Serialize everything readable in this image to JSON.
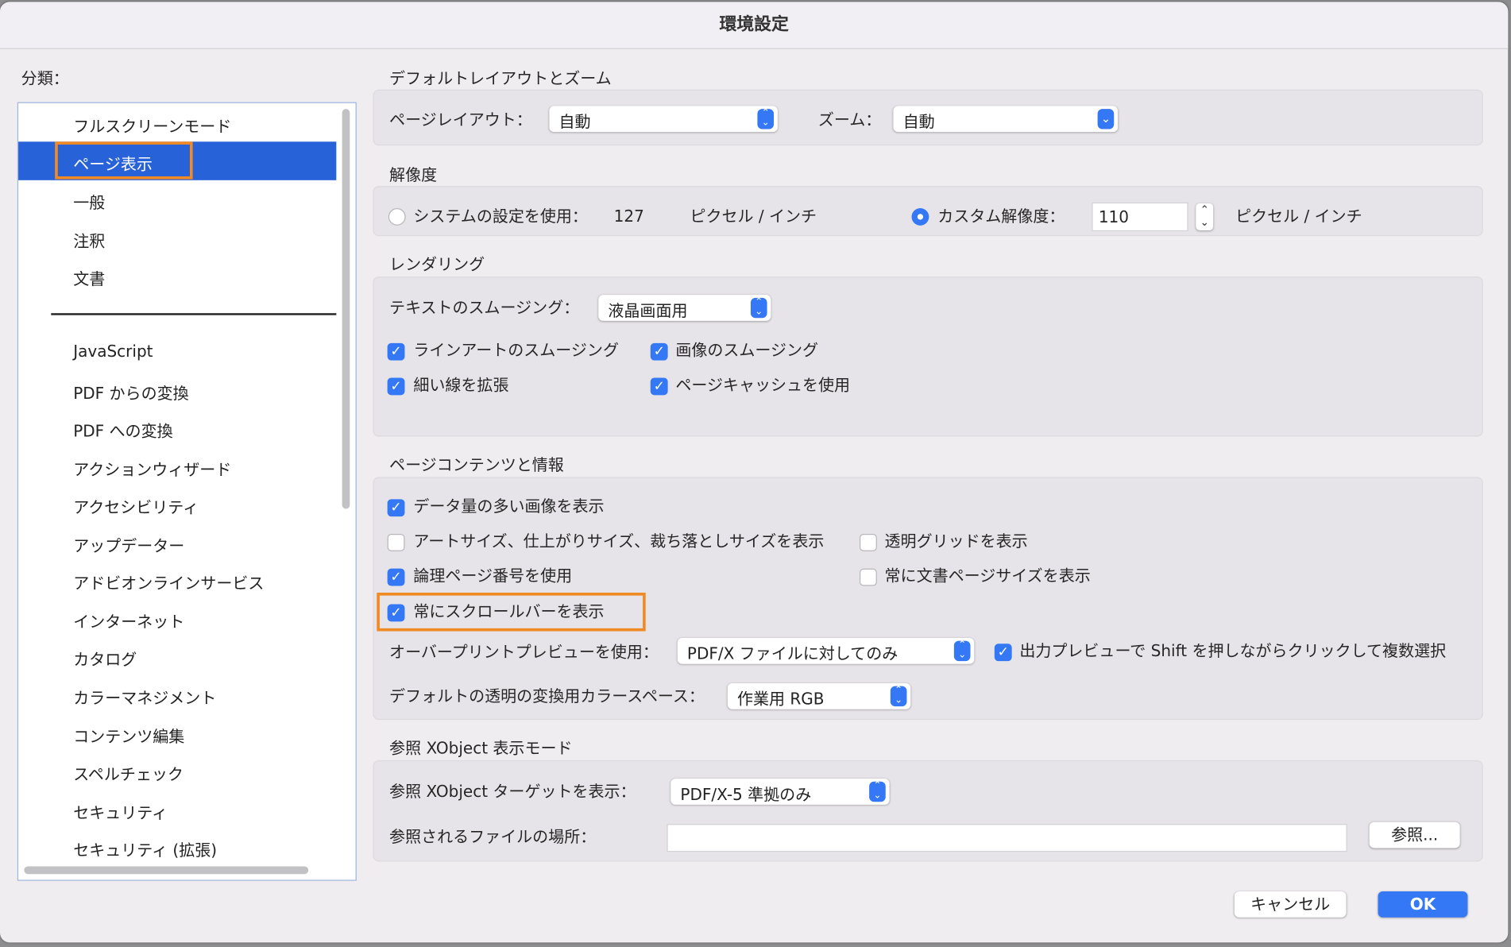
{
  "window": {
    "title": "環境設定"
  },
  "sidebar": {
    "label": "分類：",
    "items": [
      {
        "label": "フルスクリーンモード"
      },
      {
        "label": "ページ表示",
        "selected": true
      },
      {
        "label": "一般"
      },
      {
        "label": "注釈"
      },
      {
        "label": "文書"
      },
      {
        "label": "JavaScript"
      },
      {
        "label": "PDF からの変換"
      },
      {
        "label": "PDF への変換"
      },
      {
        "label": "アクションウィザード"
      },
      {
        "label": "アクセシビリティ"
      },
      {
        "label": "アップデーター"
      },
      {
        "label": "アドビオンラインサービス"
      },
      {
        "label": "インターネット"
      },
      {
        "label": "カタログ"
      },
      {
        "label": "カラーマネジメント"
      },
      {
        "label": "コンテンツ編集"
      },
      {
        "label": "スペルチェック"
      },
      {
        "label": "セキュリティ"
      },
      {
        "label": "セキュリティ (拡張)"
      }
    ]
  },
  "layout": {
    "heading": "デフォルトレイアウトとズーム",
    "page_layout_label": "ページレイアウト：",
    "page_layout_value": "自動",
    "zoom_label": "ズーム：",
    "zoom_value": "自動"
  },
  "resolution": {
    "heading": "解像度",
    "system_label": "システムの設定を使用：",
    "system_value": "127",
    "unit": "ピクセル / インチ",
    "custom_label": "カスタム解像度：",
    "custom_value": "110",
    "unit2": "ピクセル / インチ",
    "selected": "custom"
  },
  "rendering": {
    "heading": "レンダリング",
    "smoothing_label": "テキストのスムージング：",
    "smoothing_value": "液晶画面用",
    "checks": [
      {
        "label": "ラインアートのスムージング",
        "checked": true
      },
      {
        "label": "画像のスムージング",
        "checked": true
      },
      {
        "label": "細い線を拡張",
        "checked": true
      },
      {
        "label": "ページキャッシュを使用",
        "checked": true
      }
    ]
  },
  "content": {
    "heading": "ページコンテンツと情報",
    "checks": [
      {
        "label": "データ量の多い画像を表示",
        "checked": true
      },
      {
        "label": "アートサイズ、仕上がりサイズ、裁ち落としサイズを表示",
        "checked": false
      },
      {
        "label": "透明グリッドを表示",
        "checked": false
      },
      {
        "label": "論理ページ番号を使用",
        "checked": true
      },
      {
        "label": "常に文書ページサイズを表示",
        "checked": false
      },
      {
        "label": "常にスクロールバーを表示",
        "checked": true
      },
      {
        "label": "出力プレビューで Shift を押しながらクリックして複数選択",
        "checked": true
      }
    ],
    "overprint_label": "オーバープリントプレビューを使用：",
    "overprint_value": "PDF/X ファイルに対してのみ",
    "colorspace_label": "デフォルトの透明の変換用カラースペース：",
    "colorspace_value": "作業用 RGB"
  },
  "xobject": {
    "heading": "参照 XObject 表示モード",
    "target_label": "参照 XObject ターゲットを表示：",
    "target_value": "PDF/X-5 準拠のみ",
    "location_label": "参照されるファイルの場所：",
    "location_value": "",
    "browse": "参照..."
  },
  "footer": {
    "cancel": "キャンセル",
    "ok": "OK"
  },
  "colors": {
    "accent": "#3478f6",
    "selection": "#2862d9",
    "highlight": "#f08a24"
  }
}
